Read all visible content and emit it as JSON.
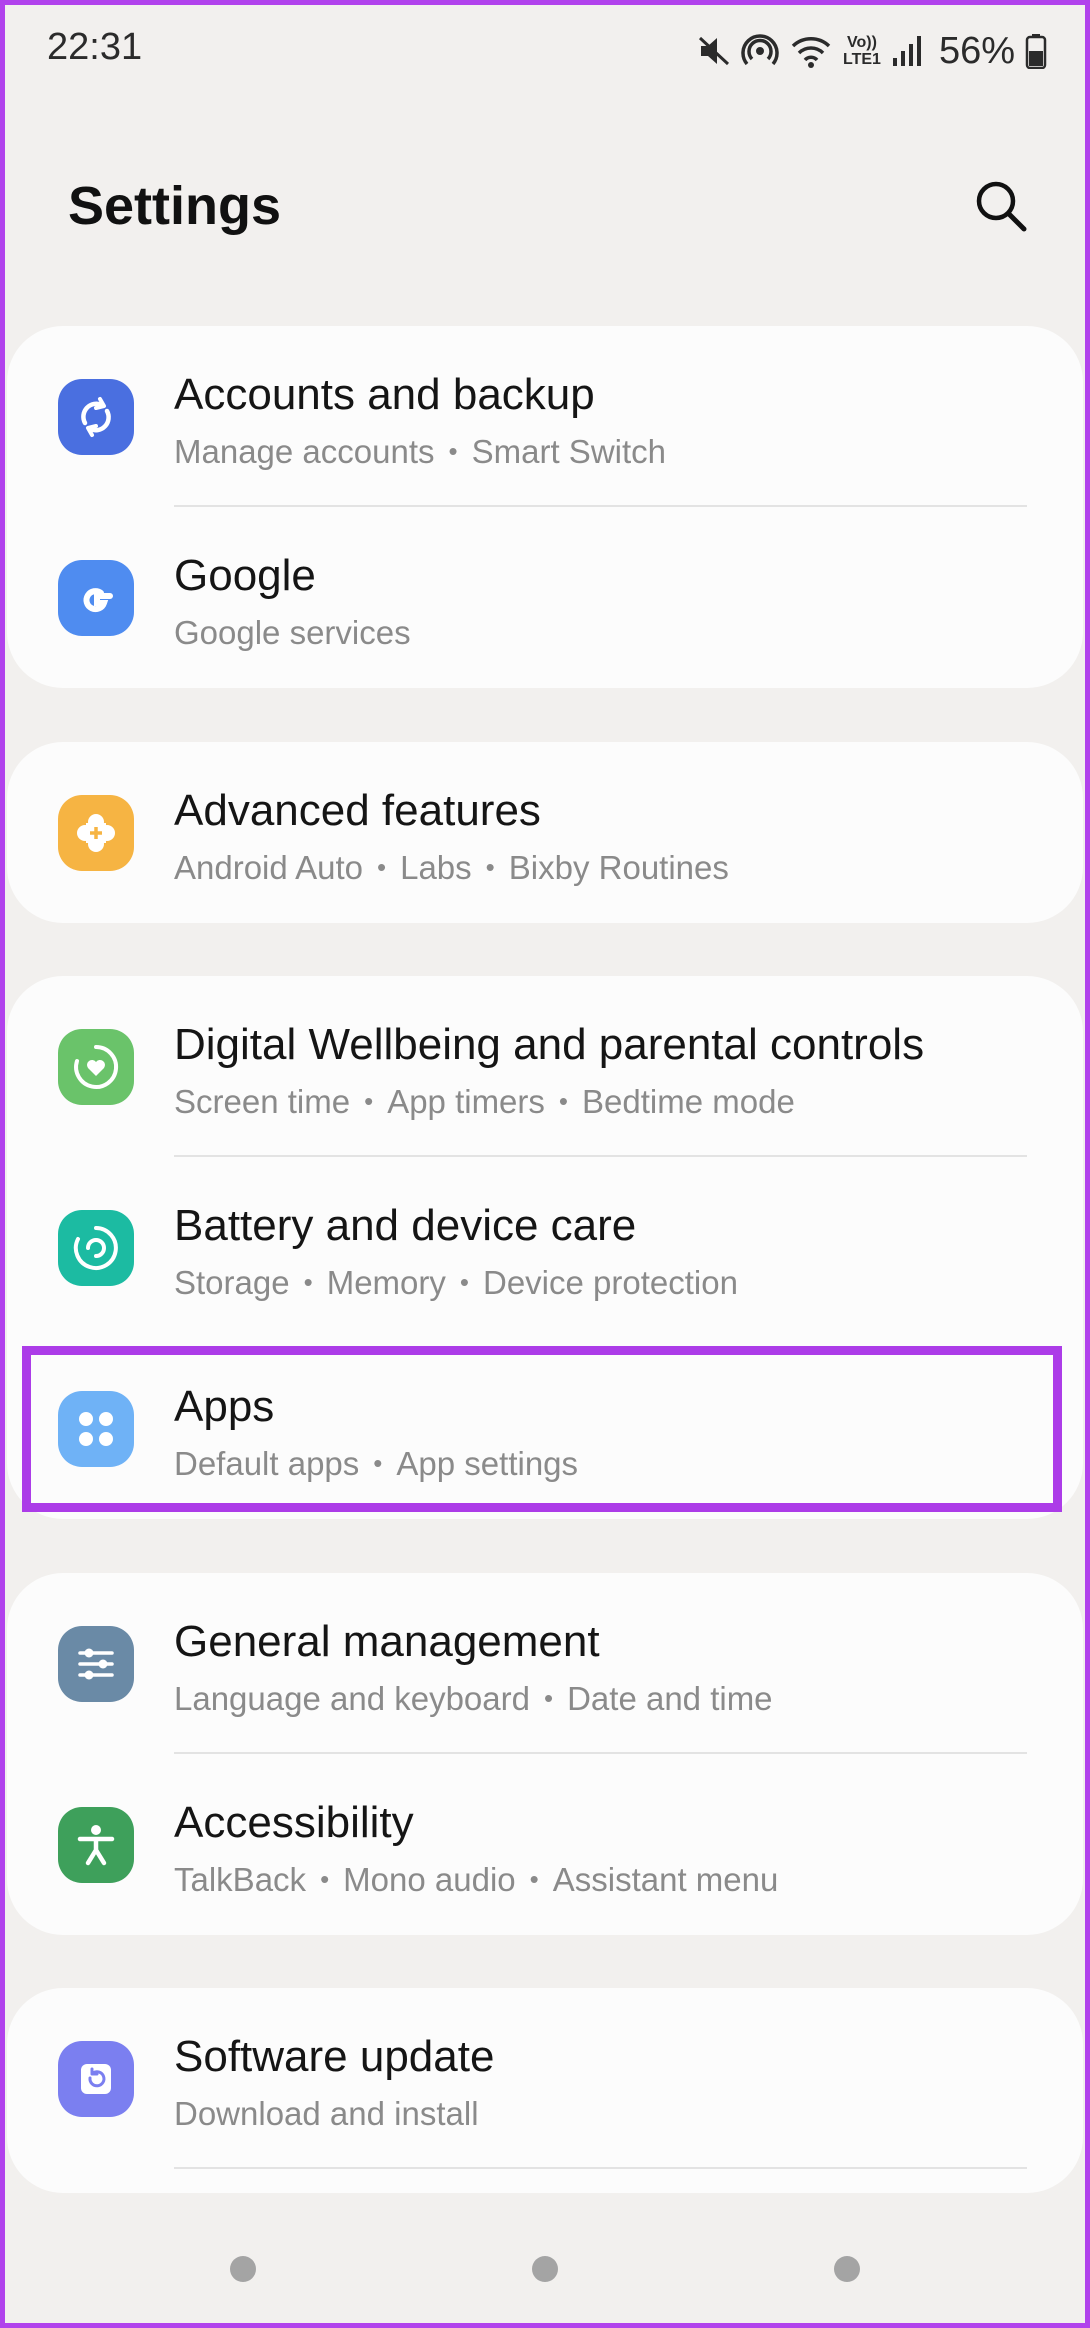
{
  "status_bar": {
    "time": "22:31",
    "battery_percent": "56%",
    "icons": [
      "mute-icon",
      "hotspot-icon",
      "wifi-icon",
      "volte-icon",
      "signal-icon",
      "battery-icon"
    ],
    "volte_line1": "Vo))",
    "volte_line2": "LTE1"
  },
  "header": {
    "title": "Settings",
    "search_icon": "search-icon"
  },
  "sections": [
    {
      "items": [
        {
          "title": "Accounts and backup",
          "subtitle": [
            "Manage accounts",
            "Smart Switch"
          ],
          "icon": "sync-icon",
          "icon_color": "#4a6fe0"
        },
        {
          "title": "Google",
          "subtitle": [
            "Google services"
          ],
          "icon": "google-icon",
          "icon_color": "#4f8cf0"
        }
      ]
    },
    {
      "items": [
        {
          "title": "Advanced features",
          "subtitle": [
            "Android Auto",
            "Labs",
            "Bixby Routines"
          ],
          "icon": "puzzle-plus-icon",
          "icon_color": "#f6b443"
        }
      ]
    },
    {
      "items": [
        {
          "title": "Digital Wellbeing and parental controls",
          "subtitle": [
            "Screen time",
            "App timers",
            "Bedtime mode"
          ],
          "icon": "wellbeing-icon",
          "icon_color": "#6ac36a"
        },
        {
          "title": "Battery and device care",
          "subtitle": [
            "Storage",
            "Memory",
            "Device protection"
          ],
          "icon": "device-care-icon",
          "icon_color": "#1cbba2"
        },
        {
          "title": "Apps",
          "subtitle": [
            "Default apps",
            "App settings"
          ],
          "icon": "apps-grid-icon",
          "icon_color": "#6fb2f6",
          "highlighted": true
        }
      ]
    },
    {
      "items": [
        {
          "title": "General management",
          "subtitle": [
            "Language and keyboard",
            "Date and time"
          ],
          "icon": "sliders-icon",
          "icon_color": "#6a8aa6"
        },
        {
          "title": "Accessibility",
          "subtitle": [
            "TalkBack",
            "Mono audio",
            "Assistant menu"
          ],
          "icon": "accessibility-icon",
          "icon_color": "#3ea05b"
        }
      ]
    },
    {
      "items": [
        {
          "title": "Software update",
          "subtitle": [
            "Download and install"
          ],
          "icon": "software-update-icon",
          "icon_color": "#7b7ff0"
        }
      ]
    }
  ],
  "nav_bar": [
    "recents-button",
    "home-button",
    "back-button"
  ],
  "colors": {
    "highlight": "#ac3ce8",
    "background": "#f2f0ee",
    "card": "#fcfcfc"
  }
}
